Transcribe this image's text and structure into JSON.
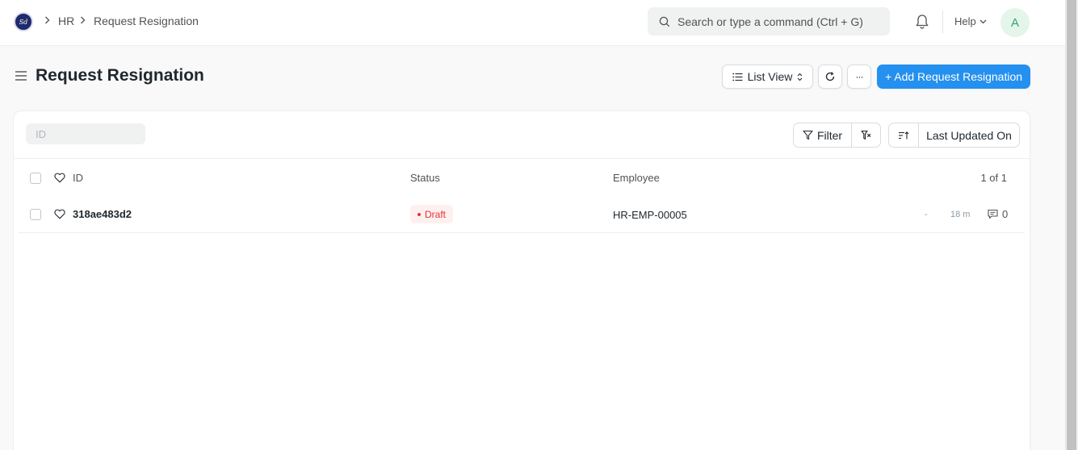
{
  "breadcrumbs": [
    "HR",
    "Request Resignation"
  ],
  "logo": {
    "text": "Sd"
  },
  "search": {
    "placeholder": "Search or type a command (Ctrl + G)"
  },
  "navbar": {
    "help_label": "Help",
    "avatar_initial": "A"
  },
  "page": {
    "title": "Request Resignation",
    "view_label": "List View",
    "more_label": "···",
    "add_label": "+ Add Request Resignation"
  },
  "list": {
    "id_filter_placeholder": "ID",
    "filter_label": "Filter",
    "sort_label": "Last Updated On",
    "columns": {
      "id": "ID",
      "status": "Status",
      "employee": "Employee"
    },
    "count": "1 of 1",
    "rows": [
      {
        "id": "318ae483d2",
        "status": "Draft",
        "employee": "HR-EMP-00005",
        "dash": "-",
        "modified": "18 m",
        "comments": "0"
      }
    ]
  },
  "colors": {
    "primary": "#2490ef",
    "draft_text": "#e03636",
    "draft_bg": "#fff0f0",
    "avatar_bg": "#e4f5e9",
    "avatar_text": "#30a66d"
  }
}
